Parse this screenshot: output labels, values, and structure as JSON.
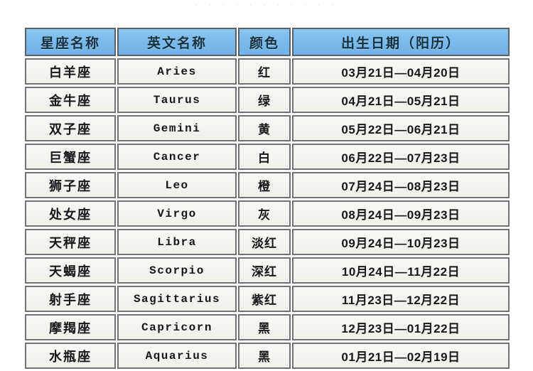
{
  "page": {
    "top_remnant": ". . . . .   .  .    . . . .",
    "header_bg_color": "#7cbcee",
    "row_bg_color": "#f2f2ee",
    "border_color": "#6f7376",
    "text_color": "#15181a"
  },
  "table": {
    "columns": [
      {
        "key": "cn_name",
        "label": "星座名称"
      },
      {
        "key": "en_name",
        "label": "英文名称"
      },
      {
        "key": "color",
        "label": "颜色"
      },
      {
        "key": "date_range",
        "label": "出生日期（阳历）"
      }
    ],
    "rows": [
      {
        "cn_name": "白羊座",
        "en_name": "Aries",
        "color": "红",
        "date_range": "03月21日—04月20日"
      },
      {
        "cn_name": "金牛座",
        "en_name": "Taurus",
        "color": "绿",
        "date_range": "04月21日—05月21日"
      },
      {
        "cn_name": "双子座",
        "en_name": "Gemini",
        "color": "黄",
        "date_range": "05月22日—06月21日"
      },
      {
        "cn_name": "巨蟹座",
        "en_name": "Cancer",
        "color": "白",
        "date_range": "06月22日—07月23日"
      },
      {
        "cn_name": "狮子座",
        "en_name": "Leo",
        "color": "橙",
        "date_range": "07月24日—08月23日"
      },
      {
        "cn_name": "处女座",
        "en_name": "Virgo",
        "color": "灰",
        "date_range": "08月24日—09月23日"
      },
      {
        "cn_name": "天秤座",
        "en_name": "Libra",
        "color": "淡红",
        "date_range": "09月24日—10月23日"
      },
      {
        "cn_name": "天蝎座",
        "en_name": "Scorpio",
        "color": "深红",
        "date_range": "10月24日—11月22日"
      },
      {
        "cn_name": "射手座",
        "en_name": "Sagittarius",
        "color": "紫红",
        "date_range": "11月23日—12月22日"
      },
      {
        "cn_name": "摩羯座",
        "en_name": "Capricorn",
        "color": "黑",
        "date_range": "12月23日—01月22日"
      },
      {
        "cn_name": "水瓶座",
        "en_name": "Aquarius",
        "color": "黑",
        "date_range": "01月21日—02月19日"
      }
    ]
  }
}
